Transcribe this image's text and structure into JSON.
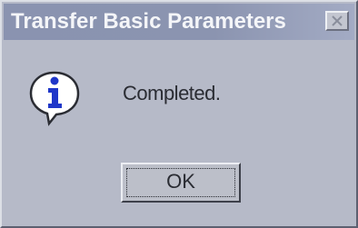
{
  "dialog": {
    "title": "Transfer Basic Parameters",
    "close_icon": "close-icon",
    "icon": "info-icon",
    "message": "Completed.",
    "ok_label": "OK"
  },
  "colors": {
    "titlebar": "#8a93b0",
    "title_text": "#f4f5f8",
    "body": "#b6bac8",
    "icon_blue": "#1f37c9"
  }
}
